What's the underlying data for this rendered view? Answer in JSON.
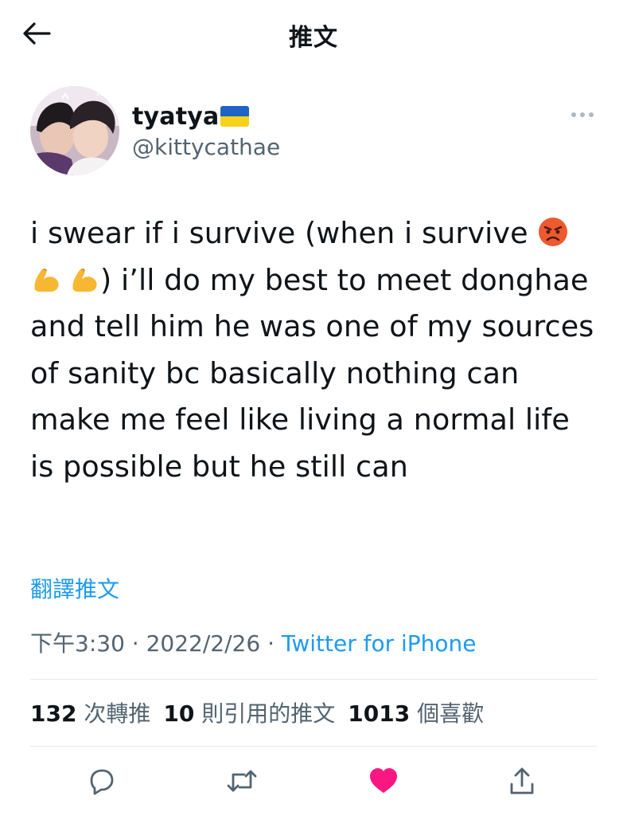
{
  "header": {
    "title": "推文"
  },
  "author": {
    "display_name": "tyatya",
    "handle": "@kittycathae"
  },
  "tweet": {
    "text_part1": "i swear if i survive (when i survive ",
    "text_part2": ") i’ll do my best to meet donghae and tell him he was one of my sources of sanity bc basically nothing can make me feel like living a normal life is possible but he still can",
    "translate_label": "翻譯推文",
    "time": "下午3:30",
    "separator": " · ",
    "date": "2022/2/26",
    "source": "Twitter for iPhone"
  },
  "stats": {
    "retweets_count": "132",
    "retweets_label": "次轉推",
    "quotes_count": "10",
    "quotes_label": "則引用的推文",
    "likes_count": "1013",
    "likes_label": "個喜歡"
  },
  "colors": {
    "accent": "#1d9bf0",
    "like": "#f91880",
    "muted": "#536471",
    "text": "#0f1419",
    "flag_blue": "#1f63c5",
    "flag_yellow": "#f5d31c"
  },
  "icons": {
    "back": "arrow-left-icon",
    "more": "more-dots-icon",
    "reply": "reply-bubble-icon",
    "retweet": "retweet-arrows-icon",
    "like": "heart-filled-icon",
    "share": "share-upload-icon"
  }
}
